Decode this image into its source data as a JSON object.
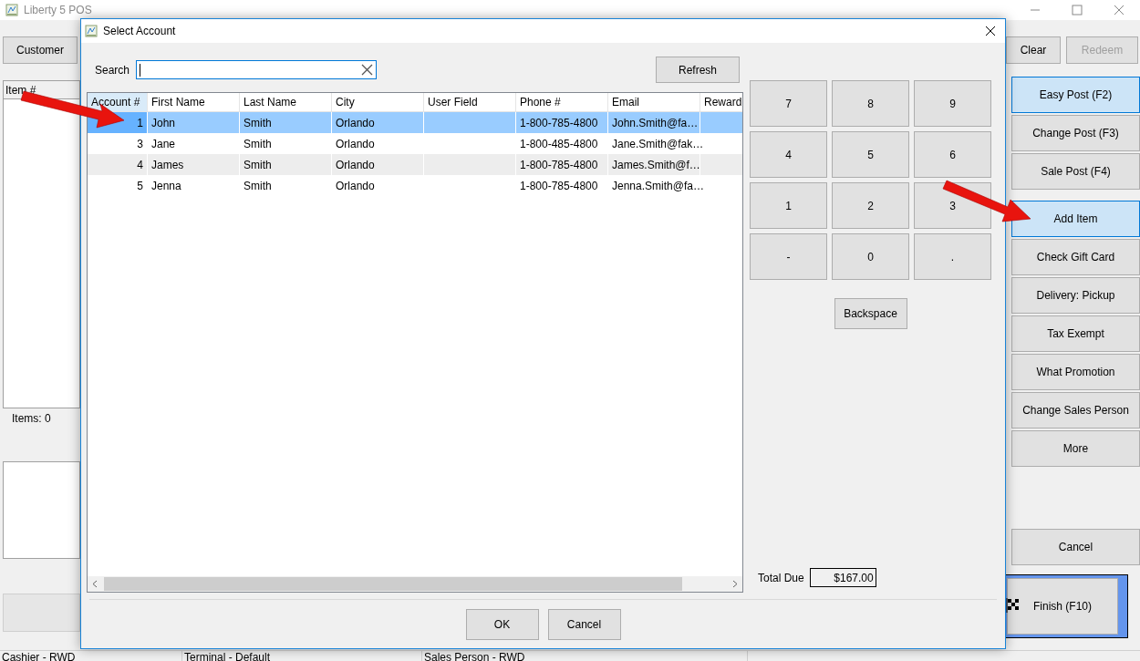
{
  "window": {
    "title": "Liberty 5 POS"
  },
  "customer_button": "Customer",
  "item_list": {
    "header": "Item #",
    "count_label": "Items: 0"
  },
  "top_buttons": [
    {
      "label": "Clear",
      "disabled": false
    },
    {
      "label": "Redeem",
      "disabled": true
    }
  ],
  "post_buttons": [
    {
      "label": "Easy Post (F2)",
      "highlighted": true
    },
    {
      "label": "Change Post (F3)",
      "highlighted": false
    },
    {
      "label": "Sale Post (F4)",
      "highlighted": false
    }
  ],
  "action_buttons": [
    {
      "label": "Add Item",
      "highlighted": true
    },
    {
      "label": "Check Gift Card",
      "highlighted": false
    },
    {
      "label": "Delivery: Pickup",
      "highlighted": false
    },
    {
      "label": "Tax Exempt",
      "highlighted": false
    },
    {
      "label": "What Promotion",
      "highlighted": false
    },
    {
      "label": "Change Sales Person",
      "highlighted": false
    },
    {
      "label": "More",
      "highlighted": false
    }
  ],
  "cancel_button": "Cancel",
  "finish_button": "Finish (F10)",
  "status_bar": [
    "Cashier - RWD",
    "Terminal - Default",
    "Sales Person - RWD"
  ],
  "dialog": {
    "title": "Select Account",
    "search_label": "Search",
    "refresh_button": "Refresh",
    "table": {
      "columns": [
        "Account #",
        "First Name",
        "Last Name",
        "City",
        "User Field",
        "Phone #",
        "Email",
        "Reward"
      ],
      "rows": [
        {
          "cells": [
            "1",
            "John",
            "Smith",
            "Orlando",
            "",
            "1-800-785-4800",
            "John.Smith@fa…",
            ""
          ],
          "selected": true
        },
        {
          "cells": [
            "3",
            "Jane",
            "Smith",
            "Orlando",
            "",
            "1-800-485-4800",
            "Jane.Smith@fak…",
            ""
          ],
          "selected": false
        },
        {
          "cells": [
            "4",
            "James",
            "Smith",
            "Orlando",
            "",
            "1-800-785-4800",
            "James.Smith@f…",
            ""
          ],
          "selected": false
        },
        {
          "cells": [
            "5",
            "Jenna",
            "Smith",
            "Orlando",
            "",
            "1-800-785-4800",
            "Jenna.Smith@fa…",
            ""
          ],
          "selected": false
        }
      ]
    },
    "keypad": [
      "7",
      "8",
      "9",
      "4",
      "5",
      "6",
      "1",
      "2",
      "3",
      "-",
      "0",
      "."
    ],
    "backspace_button": "Backspace",
    "total_label": "Total Due",
    "total_value": "$167.00",
    "buttons": [
      "OK",
      "Cancel"
    ]
  }
}
